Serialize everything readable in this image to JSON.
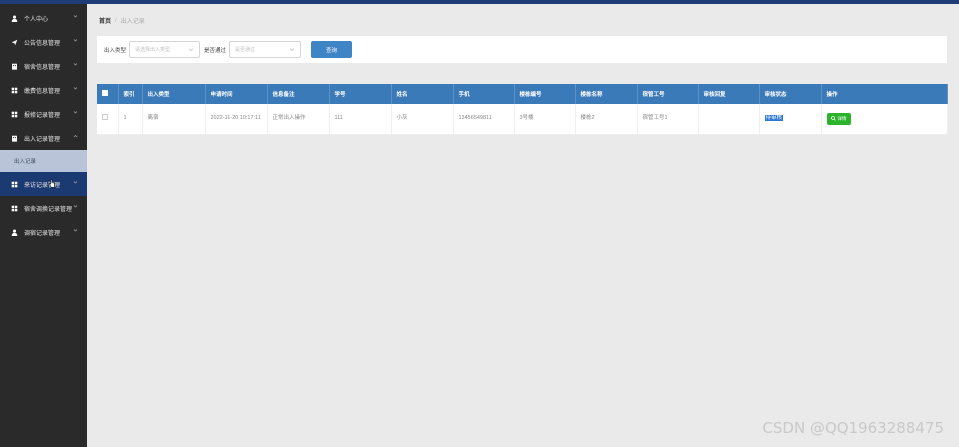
{
  "sidebar": {
    "items": [
      {
        "label": "个人中心",
        "icon": "user-icon"
      },
      {
        "label": "公告信息管理",
        "icon": "send-icon"
      },
      {
        "label": "宿舍信息管理",
        "icon": "building-icon"
      },
      {
        "label": "缴费信息管理",
        "icon": "grid-icon"
      },
      {
        "label": "报修记录管理",
        "icon": "grid-icon"
      },
      {
        "label": "出入记录管理",
        "icon": "building-icon"
      },
      {
        "label": "来访记录管理",
        "icon": "grid-icon"
      },
      {
        "label": "宿舍调换记录管理",
        "icon": "grid-icon"
      },
      {
        "label": "调宿记录管理",
        "icon": "user-icon"
      }
    ],
    "sub_item": "出入记录"
  },
  "breadcrumb": {
    "home": "首页",
    "current": "出入记录"
  },
  "search": {
    "type_label": "出入类型",
    "type_placeholder": "请选择出入类型",
    "review_label": "是否通过",
    "review_placeholder": "是否通过",
    "query_button": "查询"
  },
  "table": {
    "headers": [
      "索引",
      "出入类型",
      "申请时间",
      "信息备注",
      "学号",
      "姓名",
      "手机",
      "楼栋编号",
      "楼栋名称",
      "宿管工号",
      "审核回复",
      "审核状态",
      "操作"
    ],
    "rows": [
      {
        "index": "1",
        "type": "离宿",
        "time": "2022-11-20 10:17:11",
        "remark": "正常出入操作",
        "student_id": "111",
        "name": "小灰",
        "phone": "13456549811",
        "building_no": "3号楼",
        "building_name": "楼栋2",
        "staff_id": "宿管工号1",
        "reply": "",
        "status": "待审核",
        "action": "详情"
      }
    ]
  },
  "watermark": "CSDN @QQ1963288475",
  "colors": {
    "topbar": "#1d3c78",
    "sidebar": "#2a2a2a",
    "header": "#3a7ab9",
    "detail_button": "#2bb32b",
    "query_button": "#3f85c5"
  }
}
